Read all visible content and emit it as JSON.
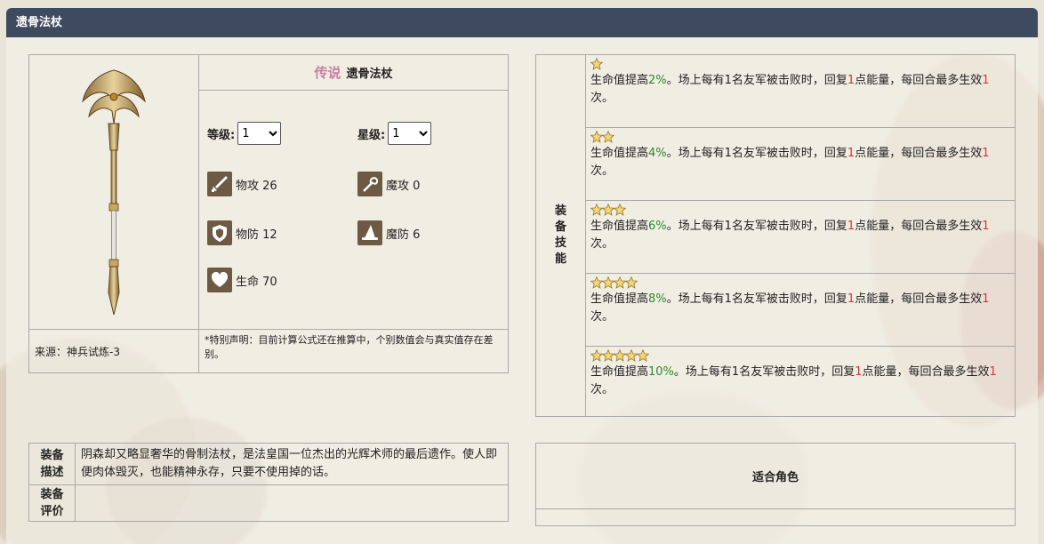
{
  "header": {
    "title": "遗骨法杖"
  },
  "weapon": {
    "rarity": "传说",
    "name": "遗骨法杖",
    "level_label": "等级:",
    "level_value": "1",
    "star_label": "星级:",
    "star_value": "1",
    "stats": [
      {
        "icon": "sword-icon",
        "label": "物攻 26"
      },
      {
        "icon": "wand-icon",
        "label": "魔攻 0"
      },
      {
        "icon": "shield-icon",
        "label": "物防 12"
      },
      {
        "icon": "wizard-hat-icon",
        "label": "魔防 6"
      },
      {
        "icon": "heart-icon",
        "label": "生命 70"
      }
    ],
    "source": "来源：神兵试炼-3",
    "note": "*特别声明：目前计算公式还在推算中，个别数值会与真实值存在差别。"
  },
  "skills": {
    "heading": "装备技能",
    "tiers": [
      {
        "stars": 1,
        "pre": "生命值提高",
        "pct": "2%",
        "mid": "。场上每有1名友军被击败时，回复",
        "num": "1",
        "post": "点能量，每回合最多生效",
        "times": "1",
        "end": "次。"
      },
      {
        "stars": 2,
        "pre": "生命值提高",
        "pct": "4%",
        "mid": "。场上每有1名友军被击败时，回复",
        "num": "1",
        "post": "点能量，每回合最多生效",
        "times": "1",
        "end": "次。"
      },
      {
        "stars": 3,
        "pre": "生命值提高",
        "pct": "6%",
        "mid": "。场上每有1名友军被击败时，回复",
        "num": "1",
        "post": "点能量，每回合最多生效",
        "times": "1",
        "end": "次。"
      },
      {
        "stars": 4,
        "pre": "生命值提高",
        "pct": "8%",
        "mid": "。场上每有1名友军被击败时，回复",
        "num": "1",
        "post": "点能量，每回合最多生效",
        "times": "1",
        "end": "次。"
      },
      {
        "stars": 5,
        "pre": "生命值提高",
        "pct": "10%",
        "mid": "。场上每有1名友军被击败时，回复",
        "num": "1",
        "post": "点能量，每回合最多生效",
        "times": "1",
        "end": "次。"
      }
    ]
  },
  "description": {
    "desc_heading": "装备描述",
    "desc_text": "阴森却又略显奢华的骨制法杖，是法皇国一位杰出的光辉术师的最后遗作。使人即便肉体毁灭，也能精神永存，只要不使用掉的话。",
    "review_heading": "装备评价",
    "review_text": ""
  },
  "roles": {
    "heading": "适合角色"
  },
  "colors": {
    "header_bg": "#3e4a5e",
    "icon_bg": "#6d5a44",
    "green": "#2d8a2d",
    "red": "#dd3333",
    "rarity": "#c97fa4"
  }
}
